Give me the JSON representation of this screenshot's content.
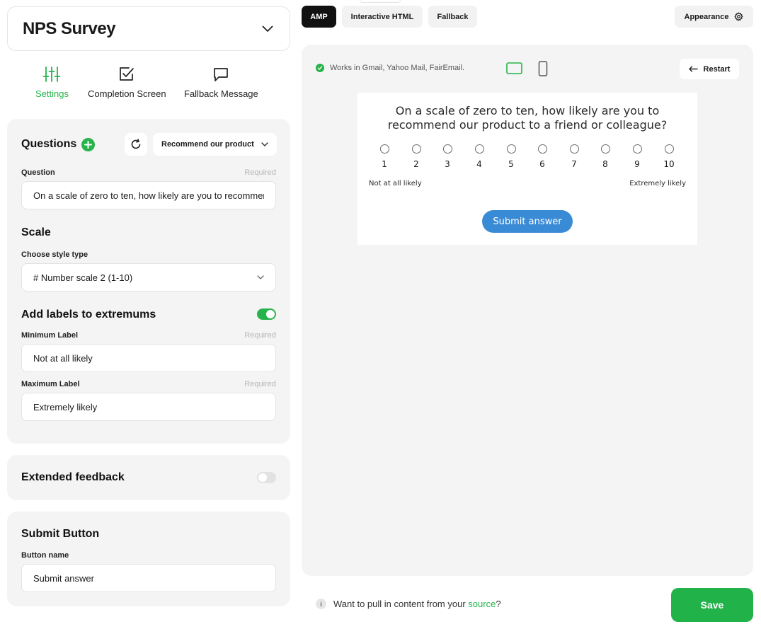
{
  "survey": {
    "title": "NPS Survey"
  },
  "settings_tabs": [
    {
      "label": "Settings",
      "icon": "sliders-icon",
      "active": true
    },
    {
      "label": "Completion Screen",
      "icon": "checkbox-icon",
      "active": false
    },
    {
      "label": "Fallback Message",
      "icon": "message-icon",
      "active": false
    }
  ],
  "questions": {
    "heading": "Questions",
    "template_select": "Recommend our product",
    "question_label": "Question",
    "question_required": "Required",
    "question_value": "On a scale of zero to ten, how likely are you to recommend our product to a friend or colleague?",
    "scale_heading": "Scale",
    "style_label": "Choose style type",
    "style_value": "# Number scale 2 (1-10)",
    "extremums_heading": "Add labels to extremums",
    "extremums_enabled": true,
    "min_label": "Minimum Label",
    "min_required": "Required",
    "min_value": "Not at all likely",
    "max_label": "Maximum Label",
    "max_required": "Required",
    "max_value": "Extremely likely"
  },
  "extended_feedback": {
    "heading": "Extended feedback",
    "enabled": false
  },
  "submit_button": {
    "heading": "Submit Button",
    "name_label": "Button name",
    "name_value": "Submit answer"
  },
  "mode_tabs": [
    {
      "label": "AMP",
      "active": true
    },
    {
      "label": "Interactive HTML",
      "active": false
    },
    {
      "label": "Fallback",
      "active": false
    }
  ],
  "appearance": {
    "label": "Appearance",
    "icon": "gear-icon"
  },
  "preview": {
    "works_in": "Works in Gmail, Yahoo Mail, FairEmail.",
    "restart_label": "Restart",
    "question": "On a scale of zero to ten, how likely are you to recommend our product to a friend or colleague?",
    "scale": [
      "1",
      "2",
      "3",
      "4",
      "5",
      "6",
      "7",
      "8",
      "9",
      "10"
    ],
    "min_label": "Not at all likely",
    "max_label": "Extremely likely",
    "submit_label": "Submit answer"
  },
  "footer": {
    "hint_prefix": "Want to pull in content from your ",
    "hint_link": "source",
    "hint_suffix": "?",
    "save_label": "Save"
  },
  "colors": {
    "accent": "#27b34b",
    "submit_blue": "#3a8bd6",
    "panel_bg": "#f4f4f4"
  }
}
